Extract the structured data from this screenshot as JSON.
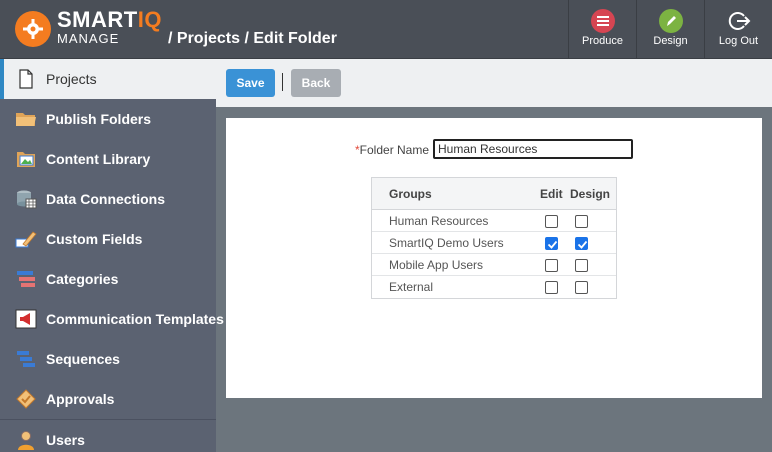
{
  "header": {
    "brand": {
      "smart": "SMART",
      "iq": "IQ",
      "manage": "MANAGE"
    },
    "breadcrumb": "/ Projects / Edit Folder",
    "buttons": [
      {
        "label": "Produce",
        "icon": "produce-icon",
        "color": "#d64552"
      },
      {
        "label": "Design",
        "icon": "pencil-icon",
        "color": "#7cb342"
      },
      {
        "label": "Log Out",
        "icon": "logout-icon",
        "color": "#4a4f57"
      }
    ]
  },
  "sidebar": {
    "items": [
      {
        "label": "Projects",
        "icon": "document-icon",
        "active": true
      },
      {
        "label": "Publish Folders",
        "icon": "folder-icon"
      },
      {
        "label": "Content Library",
        "icon": "content-library-icon"
      },
      {
        "label": "Data Connections",
        "icon": "database-icon"
      },
      {
        "label": "Custom Fields",
        "icon": "custom-fields-icon"
      },
      {
        "label": "Categories",
        "icon": "categories-icon"
      },
      {
        "label": "Communication Templates",
        "icon": "megaphone-icon"
      },
      {
        "label": "Sequences",
        "icon": "sequences-icon"
      },
      {
        "label": "Approvals",
        "icon": "approvals-icon"
      },
      {
        "label": "Users",
        "icon": "user-icon"
      }
    ]
  },
  "toolbar": {
    "save_label": "Save",
    "back_label": "Back"
  },
  "form": {
    "required_mark": "*",
    "folder_name_label": "Folder Name",
    "folder_name_value": "Human Resources"
  },
  "groups_table": {
    "headers": {
      "name": "Groups",
      "edit": "Edit",
      "design": "Design"
    },
    "rows": [
      {
        "name": "Human Resources",
        "edit": false,
        "design": false
      },
      {
        "name": "SmartIQ Demo Users",
        "edit": true,
        "design": true
      },
      {
        "name": "Mobile App Users",
        "edit": false,
        "design": false
      },
      {
        "name": "External",
        "edit": false,
        "design": false
      }
    ]
  },
  "colors": {
    "accent": "#3a92d6",
    "brand_orange": "#f47c20",
    "sidebar": "#5b6271",
    "header": "#4a4f57"
  }
}
